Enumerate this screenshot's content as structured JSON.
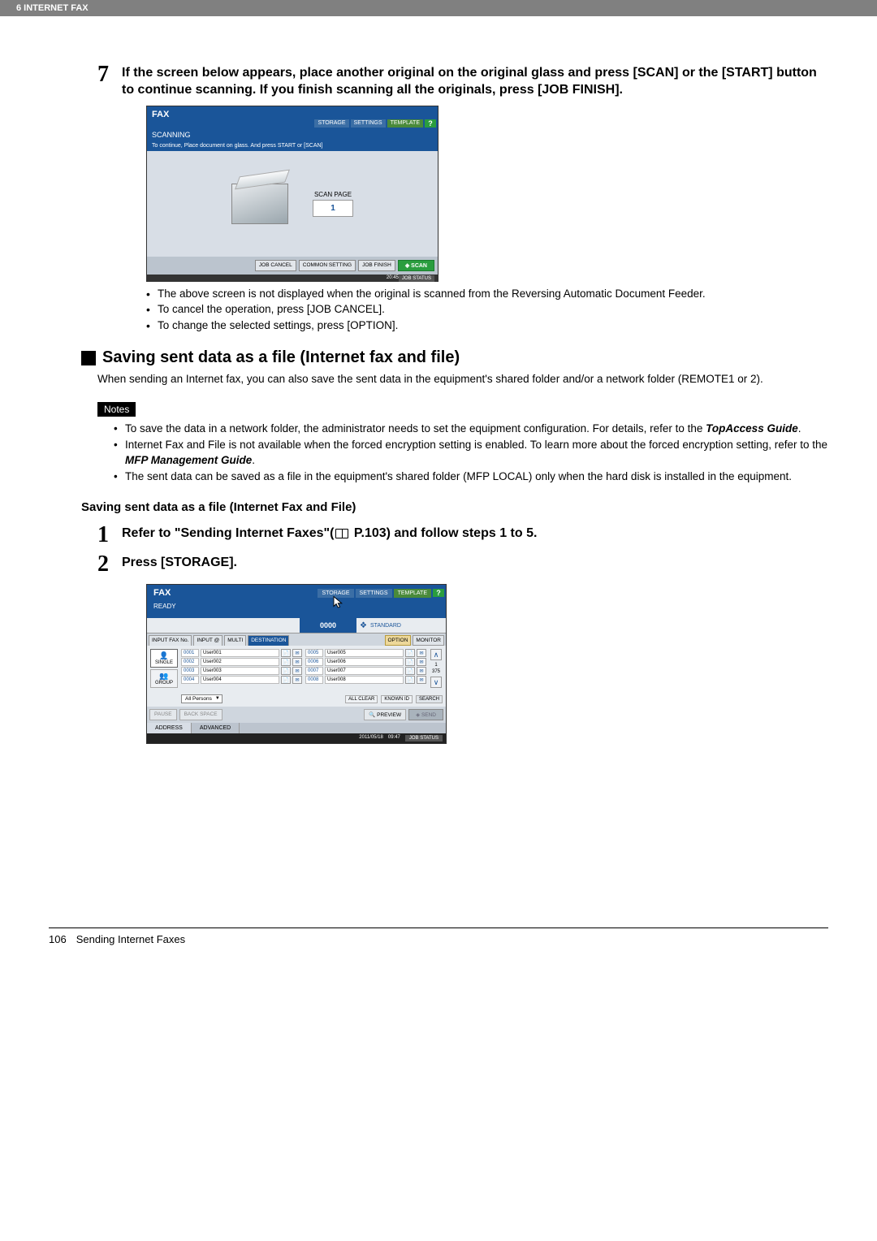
{
  "header": {
    "chapter": "6 INTERNET FAX"
  },
  "step7": {
    "number": "7",
    "text": "If the screen below appears, place another original on the original glass and press [SCAN] or the [START] button to continue scanning. If you finish scanning all the originals, press [JOB FINISH]."
  },
  "screen1": {
    "fax": "FAX",
    "storage": "STORAGE",
    "settings": "SETTINGS",
    "template": "TEMPLATE",
    "help": "?",
    "scanning": "SCANNING",
    "message": "To continue, Place document on glass. And press START or [SCAN]",
    "scanpage_label": "SCAN PAGE",
    "scanpage_value": "1",
    "job_cancel": "JOB CANCEL",
    "common_setting": "COMMON SETTING",
    "job_finish": "JOB FINISH",
    "scan": "SCAN",
    "time": "20:45",
    "jobstatus": "JOB STATUS"
  },
  "bullets1": [
    "The above screen is not displayed when the original is scanned from the Reversing Automatic Document Feeder.",
    "To cancel the operation, press [JOB CANCEL].",
    "To change the selected settings, press [OPTION]."
  ],
  "section": {
    "title": "Saving sent data as a file (Internet fax and file)",
    "para": "When sending an Internet fax, you can also save the sent data in the equipment's shared folder and/or a network folder (REMOTE1 or 2)."
  },
  "notes_label": "Notes",
  "notes": [
    {
      "pre": "To save the data in a network folder, the administrator needs to set the equipment configuration. For details, refer to the ",
      "bold": "TopAccess Guide",
      "post": "."
    },
    {
      "pre": "Internet Fax and File is not available when the forced encryption setting is enabled. To learn more about the forced encryption setting, refer to the ",
      "bold": "MFP Management Guide",
      "post": "."
    },
    {
      "pre": "The sent data can be saved as a file in the equipment's shared folder (MFP LOCAL) only when the hard disk is installed in the equipment.",
      "bold": "",
      "post": ""
    }
  ],
  "subheading": "Saving sent data as a file (Internet Fax and File)",
  "step1": {
    "number": "1",
    "pre": "Refer to \"Sending Internet Faxes\"(",
    "post": " P.103) and follow steps 1 to 5."
  },
  "step2": {
    "number": "2",
    "text": "Press [STORAGE]."
  },
  "screen2": {
    "fax": "FAX",
    "storage": "STORAGE",
    "settings": "SETTINGS",
    "template": "TEMPLATE",
    "help": "?",
    "ready": "READY",
    "counter": "0000",
    "standard": "STANDARD",
    "tabs": {
      "inputfax": "INPUT FAX No.",
      "inputat": "INPUT @",
      "multi": "MULTI",
      "destination": "DESTINATION"
    },
    "option": "OPTION",
    "monitor": "MONITOR",
    "side": {
      "single": "SINGLE",
      "group": "GROUP"
    },
    "rows_left": [
      {
        "id": "0001",
        "name": "User001"
      },
      {
        "id": "0002",
        "name": "User002"
      },
      {
        "id": "0003",
        "name": "User003"
      },
      {
        "id": "0004",
        "name": "User004"
      }
    ],
    "rows_right": [
      {
        "id": "0005",
        "name": "User005"
      },
      {
        "id": "0006",
        "name": "User006"
      },
      {
        "id": "0007",
        "name": "User007"
      },
      {
        "id": "0008",
        "name": "User008"
      }
    ],
    "page_current": "1",
    "page_total": "375",
    "allpersons": "All Persons",
    "allclear": "ALL CLEAR",
    "knownid": "KNOWN ID",
    "search": "SEARCH",
    "pause": "PAUSE",
    "backspace": "BACK SPACE",
    "preview": "PREVIEW",
    "send": "SEND",
    "tab_address": "ADDRESS",
    "tab_advanced": "ADVANCED",
    "date": "2011/05/18",
    "time": "09:47",
    "jobstatus": "JOB STATUS"
  },
  "footer": {
    "page": "106",
    "title": "Sending Internet Faxes"
  }
}
